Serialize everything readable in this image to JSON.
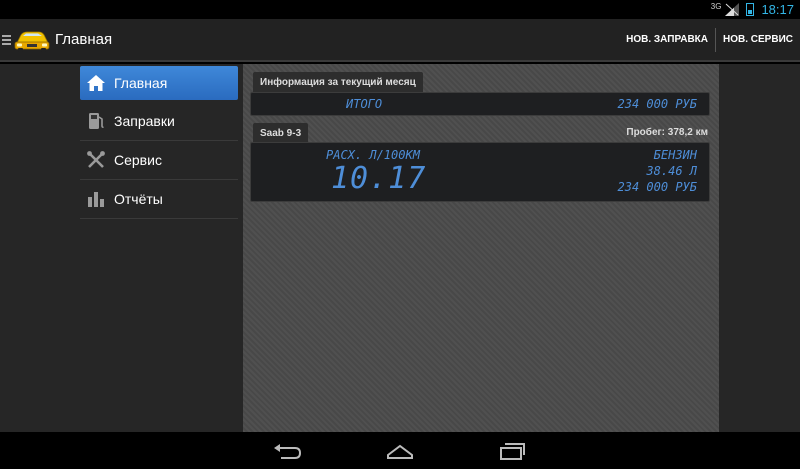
{
  "status": {
    "network": "3G",
    "time": "18:17"
  },
  "actionbar": {
    "title": "Главная",
    "actions": [
      "НОВ. ЗАПРАВКА",
      "НОВ. СЕРВИС"
    ]
  },
  "sidebar": {
    "items": [
      {
        "label": "Главная",
        "icon": "home-icon"
      },
      {
        "label": "Заправки",
        "icon": "fuel-pump-icon"
      },
      {
        "label": "Сервис",
        "icon": "tools-icon"
      },
      {
        "label": "Отчёты",
        "icon": "bar-chart-icon"
      }
    ]
  },
  "month": {
    "header": "Информация за текущий месяц",
    "total_label": "ИТОГО",
    "total_value": "234 000 РУБ"
  },
  "car": {
    "name": "Saab 9-3",
    "mileage": "Пробег: 378,2 км",
    "consumption_label": "РАСХ. Л/100КМ",
    "consumption_value": "10.17",
    "fuel_type": "БЕНЗИН",
    "fuel_volume": "38.46 Л",
    "fuel_cost": "234 000 РУБ"
  },
  "colors": {
    "accent": "#33b5e5",
    "lcd": "#4e8ed8",
    "selected": "#3277c9"
  }
}
